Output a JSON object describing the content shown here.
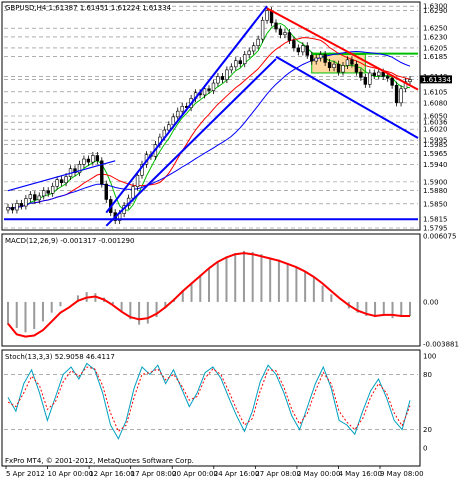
{
  "header": {
    "symbol_line": "GBPUSD,H4  1.61387 1.61451 1.61224 1.61334",
    "macd_label": "MACD(12,26,9) -0.001317 -0.001290",
    "stoch_label": "Stoch(13,3,3) 52.9058 46.4117",
    "copyright": "FxPro MT4, © 2001-2012, MetaQuotes Software Corp."
  },
  "colors": {
    "background": "#ffffff",
    "grid": "#7f7f7f",
    "candle": "#000000",
    "trend_blue": "#0000ff",
    "trend_red": "#ff0000",
    "ma_green": "#00c000",
    "ma_red": "#ff0000",
    "ma_blue": "#0000ff",
    "macd_signal": "#ff0000",
    "macd_hist": "#9a9a9a",
    "stoch_main": "#00a0c0",
    "stoch_signal": "#ff0000",
    "current_price_box": "#000000",
    "box_fill": "#ffd9a0"
  },
  "chart_data": [
    {
      "type": "candlestick",
      "title": "GBPUSD,H4",
      "x_tick_labels": [
        "5 Apr 2012",
        "10 Apr 00:00",
        "12 Apr 16:00",
        "17 Apr 08:00",
        "20 Apr 00:00",
        "24 Apr 16:00",
        "27 Apr 08:00",
        "2 May 00:00",
        "4 May 16:00",
        "9 May 08:00"
      ],
      "y_tick_labels": [
        "1.6300",
        "1.6290",
        "1.6250",
        "1.6230",
        "1.6205",
        "1.6185",
        "1.6140",
        "1.6133",
        "1.6105",
        "1.6080",
        "1.6050",
        "1.6036",
        "1.6020",
        "1.5995",
        "1.5985",
        "1.5965",
        "1.5940",
        "1.5900",
        "1.5880",
        "1.5850",
        "1.5815",
        "1.5795"
      ],
      "ylim": [
        1.5795,
        1.6305
      ],
      "current_price": "1.61334",
      "candles_close": [
        1.5842,
        1.5836,
        1.5851,
        1.5845,
        1.5862,
        1.5871,
        1.5859,
        1.5868,
        1.588,
        1.5874,
        1.589,
        1.5905,
        1.5898,
        1.5912,
        1.593,
        1.5921,
        1.594,
        1.5952,
        1.5945,
        1.596,
        1.5948,
        1.5895,
        1.586,
        1.583,
        1.5812,
        1.5828,
        1.5846,
        1.5863,
        1.5889,
        1.5915,
        1.594,
        1.5962,
        1.5958,
        1.5985,
        1.6002,
        1.6018,
        1.603,
        1.6048,
        1.6061,
        1.6072,
        1.6069,
        1.609,
        1.6103,
        1.6098,
        1.6112,
        1.6108,
        1.6125,
        1.614,
        1.6133,
        1.6155,
        1.6162,
        1.6176,
        1.6169,
        1.619,
        1.6198,
        1.621,
        1.6225,
        1.6268,
        1.629,
        1.6262,
        1.6248,
        1.6235,
        1.624,
        1.6222,
        1.6205,
        1.6196,
        1.621,
        1.6188,
        1.6175,
        1.6182,
        1.619,
        1.6172,
        1.616,
        1.6168,
        1.615,
        1.6165,
        1.6178,
        1.6168,
        1.615,
        1.6138,
        1.6122,
        1.6148,
        1.6142,
        1.615,
        1.614,
        1.6136,
        1.612,
        1.608,
        1.6112,
        1.6128,
        1.6133
      ],
      "trendlines": [
        {
          "name": "channel-upper",
          "color": "blue"
        },
        {
          "name": "channel-lower",
          "color": "blue"
        },
        {
          "name": "down-channel-upper",
          "color": "red"
        },
        {
          "name": "down-channel-lower",
          "color": "blue"
        },
        {
          "name": "support-horizontal",
          "color": "blue"
        }
      ]
    },
    {
      "type": "macd",
      "title": "MACD(12,26,9)",
      "y_tick_labels": [
        "0.006075",
        "0.00",
        "-0.003881"
      ],
      "ylim": [
        -0.003881,
        0.006075
      ],
      "histogram": [
        -0.0021,
        -0.0024,
        -0.0028,
        -0.0025,
        -0.0018,
        -0.001,
        -0.0004,
        0.0,
        0.0006,
        0.0009,
        0.0008,
        0.0004,
        -0.0002,
        -0.0009,
        -0.0016,
        -0.0021,
        -0.002,
        -0.0014,
        -0.0006,
        0.0003,
        0.0011,
        0.0018,
        0.0025,
        0.0031,
        0.0037,
        0.0042,
        0.0045,
        0.0047,
        0.0046,
        0.0044,
        0.0041,
        0.0039,
        0.0036,
        0.0032,
        0.0028,
        0.0022,
        0.0015,
        0.0007,
        0.0,
        -0.0006,
        -0.001,
        -0.0013,
        -0.0014,
        -0.0013,
        -0.0015,
        -0.0014,
        -0.0013
      ],
      "signal": [
        -0.002,
        -0.003,
        -0.0032,
        -0.0031,
        -0.0026,
        -0.0018,
        -0.001,
        -0.0005,
        0.0001,
        0.0004,
        0.0005,
        0.0002,
        -0.0003,
        -0.0009,
        -0.0014,
        -0.0016,
        -0.0015,
        -0.0011,
        -0.0005,
        0.0002,
        0.001,
        0.0017,
        0.0024,
        0.0031,
        0.0037,
        0.0041,
        0.0044,
        0.0045,
        0.0044,
        0.0042,
        0.004,
        0.0038,
        0.0035,
        0.0032,
        0.0028,
        0.0023,
        0.0017,
        0.001,
        0.0003,
        -0.0003,
        -0.0008,
        -0.0011,
        -0.0013,
        -0.0012,
        -0.0012,
        -0.0013,
        -0.0013
      ]
    },
    {
      "type": "stochastic",
      "title": "Stoch(13,3,3)",
      "y_tick_labels": [
        "100",
        "80",
        "20",
        "0"
      ],
      "ylim": [
        0,
        100
      ],
      "main": [
        55,
        40,
        70,
        85,
        60,
        30,
        55,
        80,
        88,
        75,
        92,
        85,
        60,
        25,
        10,
        30,
        65,
        88,
        80,
        90,
        70,
        85,
        65,
        45,
        60,
        82,
        88,
        76,
        55,
        35,
        18,
        40,
        72,
        90,
        80,
        60,
        35,
        20,
        45,
        70,
        88,
        65,
        30,
        25,
        15,
        40,
        62,
        75,
        55,
        30,
        20,
        52
      ],
      "signal": [
        50,
        45,
        60,
        78,
        68,
        42,
        50,
        72,
        84,
        78,
        88,
        86,
        68,
        38,
        18,
        25,
        55,
        80,
        82,
        86,
        74,
        80,
        68,
        52,
        56,
        76,
        86,
        80,
        62,
        42,
        25,
        32,
        62,
        85,
        84,
        66,
        42,
        26,
        38,
        62,
        82,
        70,
        40,
        28,
        20,
        32,
        55,
        70,
        60,
        38,
        24,
        46
      ]
    }
  ]
}
